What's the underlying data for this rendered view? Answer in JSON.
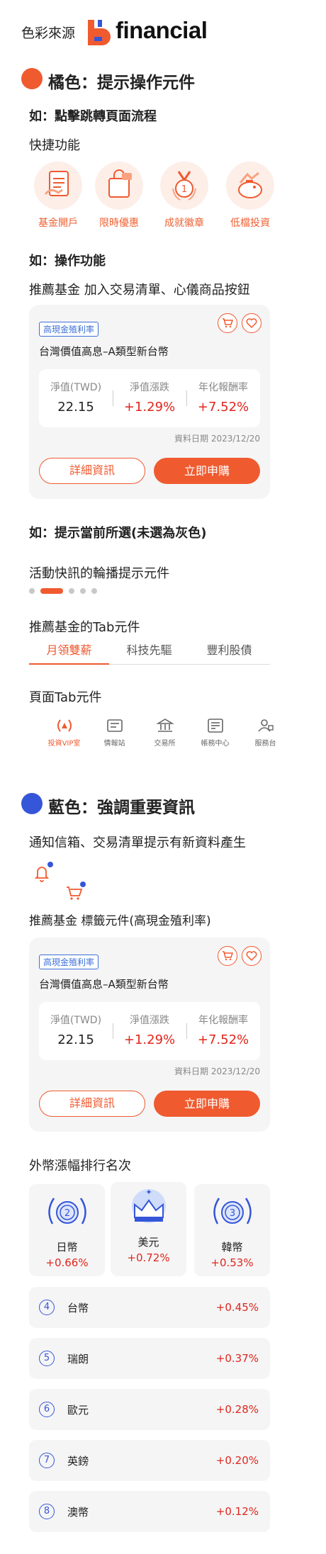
{
  "header": {
    "title": "色彩來源",
    "logo_text": "financial"
  },
  "colors": {
    "orange": "#f05a2f",
    "blue": "#3556d8",
    "red": "#e0261c"
  },
  "orange_section": {
    "title": "橘色：提示操作元件",
    "example1": "如：點擊跳轉頁面流程",
    "quick_title": "快捷功能",
    "quick_items": [
      {
        "label": "基金開戶",
        "icon": "fund-account-icon"
      },
      {
        "label": "限時優惠",
        "icon": "shopping-bag-icon"
      },
      {
        "label": "成就徽章",
        "icon": "medal-icon"
      },
      {
        "label": "低檔投資",
        "icon": "piggy-bank-icon"
      }
    ],
    "example2": "如：操作功能",
    "fund_title": "推薦基金 加入交易清單、心儀商品按鈕",
    "example3": "如：提示當前所選(未選為灰色)",
    "carousel_title": "活動快訊的輪播提示元件",
    "tab_title": "推薦基金的Tab元件",
    "tabs": [
      "月領雙薪",
      "科技先驅",
      "豐利股債"
    ],
    "pagetab_title": "頁面Tab元件",
    "pagetabs": [
      {
        "label": "投資VIP室",
        "icon": "laurel-icon"
      },
      {
        "label": "情報站",
        "icon": "news-icon"
      },
      {
        "label": "交易所",
        "icon": "bank-icon"
      },
      {
        "label": "帳務中心",
        "icon": "statement-icon"
      },
      {
        "label": "服務台",
        "icon": "service-icon"
      }
    ]
  },
  "fund_card": {
    "tag": "高現金殖利率",
    "name": "台灣價值高息–A類型新台幣",
    "stats": [
      {
        "label": "淨值(TWD)",
        "value": "22.15"
      },
      {
        "label": "淨值漲跌",
        "value": "+1.29%"
      },
      {
        "label": "年化報酬率",
        "value": "+7.52%"
      }
    ],
    "date": "資料日期 2023/12/20",
    "detail_btn": "詳細資訊",
    "buy_btn": "立即申購"
  },
  "blue_section": {
    "title": "藍色：強調重要資訊",
    "notify_title": "通知信箱、交易清單提示有新資料產生",
    "fund_title": "推薦基金 標籤元件(高現金殖利率)",
    "ranking_title": "外幣漲幅排行名次",
    "podium": [
      {
        "rank": "2",
        "name": "日幣",
        "value": "+0.66%"
      },
      {
        "rank": "1",
        "name": "美元",
        "value": "+0.72%"
      },
      {
        "rank": "3",
        "name": "韓幣",
        "value": "+0.53%"
      }
    ],
    "rows": [
      {
        "rank": "4",
        "name": "台幣",
        "value": "+0.45%"
      },
      {
        "rank": "5",
        "name": "瑞朗",
        "value": "+0.37%"
      },
      {
        "rank": "6",
        "name": "歐元",
        "value": "+0.28%"
      },
      {
        "rank": "7",
        "name": "英鎊",
        "value": "+0.20%"
      },
      {
        "rank": "8",
        "name": "澳幣",
        "value": "+0.12%"
      }
    ]
  }
}
